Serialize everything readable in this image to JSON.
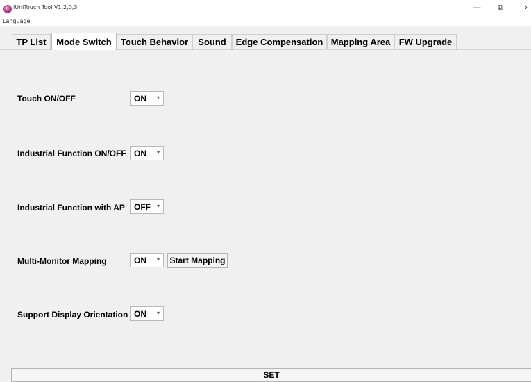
{
  "window": {
    "title": "iUniTouch Tool V1,2,0,3",
    "app_icon": "app-logo-icon",
    "controls": {
      "minimize": "—",
      "maximize": "⧉",
      "close": "›"
    }
  },
  "menu": {
    "language": "Language"
  },
  "tabs": [
    {
      "label": "TP List"
    },
    {
      "label": "Mode Switch",
      "active": true
    },
    {
      "label": "Touch Behavior"
    },
    {
      "label": "Sound"
    },
    {
      "label": "Edge Compensation"
    },
    {
      "label": "Mapping Area"
    },
    {
      "label": "FW Upgrade"
    }
  ],
  "settings": [
    {
      "label": "Touch ON/OFF",
      "value": "ON"
    },
    {
      "label": "Industrial Function ON/OFF",
      "value": "ON"
    },
    {
      "label": "Industrial Function with AP",
      "value": "OFF"
    },
    {
      "label": "Multi-Monitor Mapping",
      "value": "ON",
      "button": "Start Mapping"
    },
    {
      "label": "Support Display Orientation",
      "value": "ON"
    }
  ],
  "combo_arrow": "▾",
  "set_button": "SET"
}
